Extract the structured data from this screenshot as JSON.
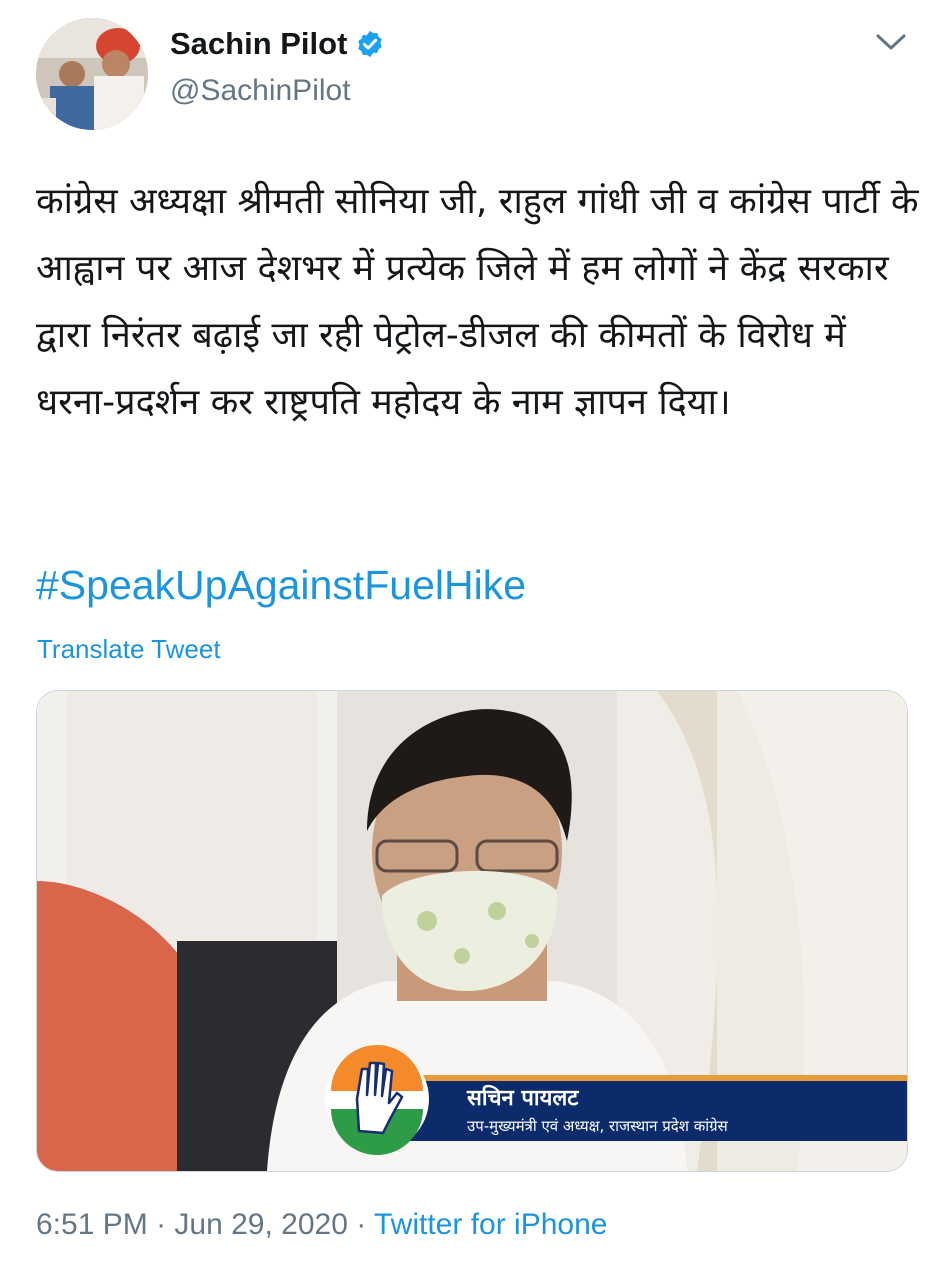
{
  "author": {
    "name": "Sachin Pilot",
    "handle": "@SachinPilot"
  },
  "tweet": {
    "text": "कांग्रेस अध्यक्षा श्रीमती सोनिया जी, राहुल गांधी जी व कांग्रेस पार्टी के आह्वान पर आज देशभर में प्रत्येक जिले में हम लोगों ने केंद्र सरकार द्वारा निरंतर बढ़ाई जा रही पेट्रोल-डीजल की कीमतों के विरोध में धरना-प्रदर्शन कर राष्ट्रपति महोदय के नाम ज्ञापन दिया।",
    "hashtag": "#SpeakUpAgainstFuelHike",
    "translate_label": "Translate Tweet"
  },
  "media": {
    "caption_name": "सचिन पायलट",
    "caption_title": "उप-मुख्यमंत्री एवं अध्यक्ष, राजस्थान प्रदेश कांग्रेस"
  },
  "meta": {
    "time": "6:51 PM",
    "separator": " · ",
    "date": "Jun 29, 2020",
    "source": "Twitter for iPhone"
  },
  "colors": {
    "link": "#1b95e0",
    "secondary_text": "#657786",
    "verified": "#1da1f2"
  },
  "icons": [
    "verified-badge-icon",
    "chevron-down-icon",
    "congress-hand-logo"
  ]
}
